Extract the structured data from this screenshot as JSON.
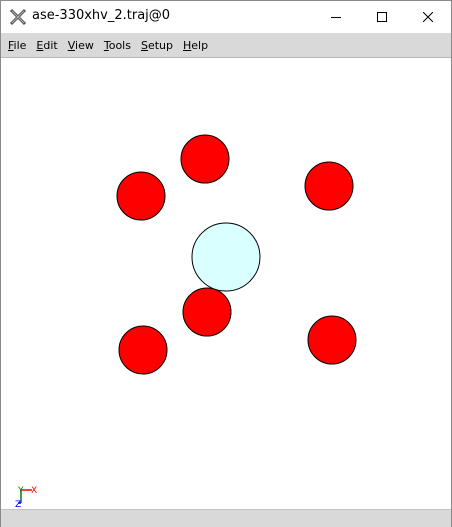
{
  "window": {
    "title": "ase-330xhv_2.traj@0",
    "app_icon": "ase-x-logo-icon",
    "controls": [
      "minimize-icon",
      "maximize-icon",
      "close-icon"
    ]
  },
  "menubar": {
    "items": [
      {
        "label": "File",
        "mnemonic": "F",
        "rest": "ile"
      },
      {
        "label": "Edit",
        "mnemonic": "E",
        "rest": "dit"
      },
      {
        "label": "View",
        "mnemonic": "V",
        "rest": "iew"
      },
      {
        "label": "Tools",
        "mnemonic": "T",
        "rest": "ools"
      },
      {
        "label": "Setup",
        "mnemonic": "S",
        "rest": "etup"
      },
      {
        "label": "Help",
        "mnemonic": "H",
        "rest": "elp"
      }
    ]
  },
  "atoms": [
    {
      "element": "O",
      "color": "#ff0000"
    },
    {
      "element": "O",
      "color": "#ff0000"
    },
    {
      "element": "O",
      "color": "#ff0000"
    },
    {
      "element": "O",
      "color": "#ff0000"
    },
    {
      "element": "O",
      "color": "#ff0000"
    },
    {
      "element": "O",
      "color": "#ff0000"
    },
    {
      "element": "He",
      "color": "#d9ffff"
    }
  ],
  "axes": {
    "x_label": "X",
    "y_label": "Y",
    "z_label": "Z",
    "x_color": "#ff0000",
    "y_color": "#008000",
    "z_color": "#0000ff"
  },
  "statusbar": {
    "text": ""
  }
}
